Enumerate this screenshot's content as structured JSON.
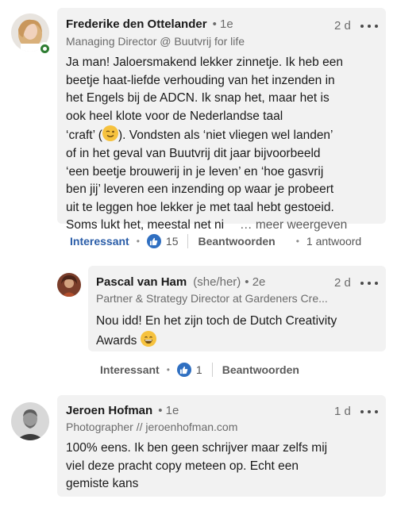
{
  "comments": [
    {
      "author": "Frederike den Ottelander",
      "degree": "• 1e",
      "time": "2 d",
      "headline": "Managing Director @ Buutvrij for life",
      "body_lines": [
        "Ja man! Jaloersmakend lekker zinnetje. Ik heb een",
        "beetje haat-liefde verhouding van het inzenden in",
        "het Engels bij de ADCN. Ik snap het, maar het is",
        "ook heel klote voor de Nederlandse taal",
        "‘craft’ (",
        "). Vondsten als ‘niet vliegen wel landen’",
        "of in het geval van Buutvrij dit jaar bijvoorbeeld",
        "‘een beetje brouwerij in je leven’ en ‘hoe gasvrij",
        "ben jij’ leveren een inzending op waar je probeert",
        "uit te leggen hoe lekker je met taal hebt gestoeid.",
        "Soms lukt het, meestal net ni"
      ],
      "see_more": "… meer weergeven",
      "actions": {
        "interesting": "Interessant",
        "likes": "15",
        "reply": "Beantwoorden",
        "replies": "1 antwoord"
      }
    },
    {
      "author": "Pascal van Ham",
      "pronouns": "(she/her)",
      "degree": "• 2e",
      "time": "2 d",
      "headline": "Partner & Strategy Director at Gardeners Cre...",
      "body_lines": [
        "Nou idd! En het zijn toch de Dutch Creativity",
        "Awards"
      ],
      "actions": {
        "interesting": "Interessant",
        "likes": "1",
        "reply": "Beantwoorden"
      }
    },
    {
      "author": "Jeroen Hofman",
      "degree": "• 1e",
      "time": "1 d",
      "headline": "Photographer // jeroenhofman.com",
      "body_lines": [
        "100% eens. Ik ben geen schrijver maar zelfs mij",
        "viel deze pracht copy meteen op. Echt een",
        "gemiste kans"
      ]
    }
  ],
  "colors": {
    "bubble": "#f2f2f2",
    "link_blue": "#2a5da8",
    "like_blue": "#2f6fc1",
    "online_green": "#2e7d32"
  },
  "icons": [
    "more-icon",
    "like-icon",
    "wink-emoji",
    "grin-emoji",
    "online-badge-icon"
  ]
}
